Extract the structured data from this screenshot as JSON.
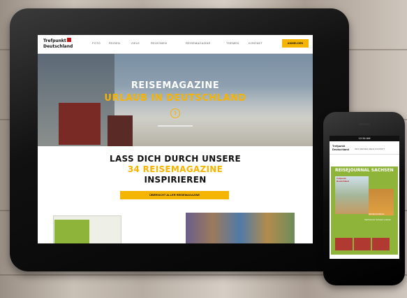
{
  "tablet": {
    "logo_line1": "Trefpunkt",
    "logo_line2": "Deutschland",
    "nav_items": [
      "FOTO",
      "REISEN",
      "ZIELE",
      "REGIONEN",
      "REISEMAGAZINE",
      "THEMEN",
      "KONTAKT"
    ],
    "nav_cta": "ANMELDEN",
    "hero_title": "REISEMAGAZINE",
    "hero_subtitle": "URLAUB IN DEUTSCHLAND",
    "section_line1": "LASS DICH DURCH UNSERE",
    "section_line2": "34 REISEMAGAZINE",
    "section_line3": "INSPIRIEREN",
    "section_button": "ÜBERSICHT ALLER REISEMAGAZINE",
    "colors": {
      "accent": "#f5b400",
      "green": "#8fb43a",
      "dark": "#111111"
    }
  },
  "phone": {
    "status_time": "12:34 AM",
    "nav_text": "INFO  REISEN  ZIELE  KONTAKT",
    "logo_line1": "Trefpunkt",
    "logo_line2": "Deutschland",
    "title": "REISEJOURNAL SACHSEN",
    "cover_label": "REISEJOURNAL",
    "cover_sub": "Sächsische Schweiz erleben"
  },
  "icons": {
    "hero_button": "arrow-right-icon"
  }
}
